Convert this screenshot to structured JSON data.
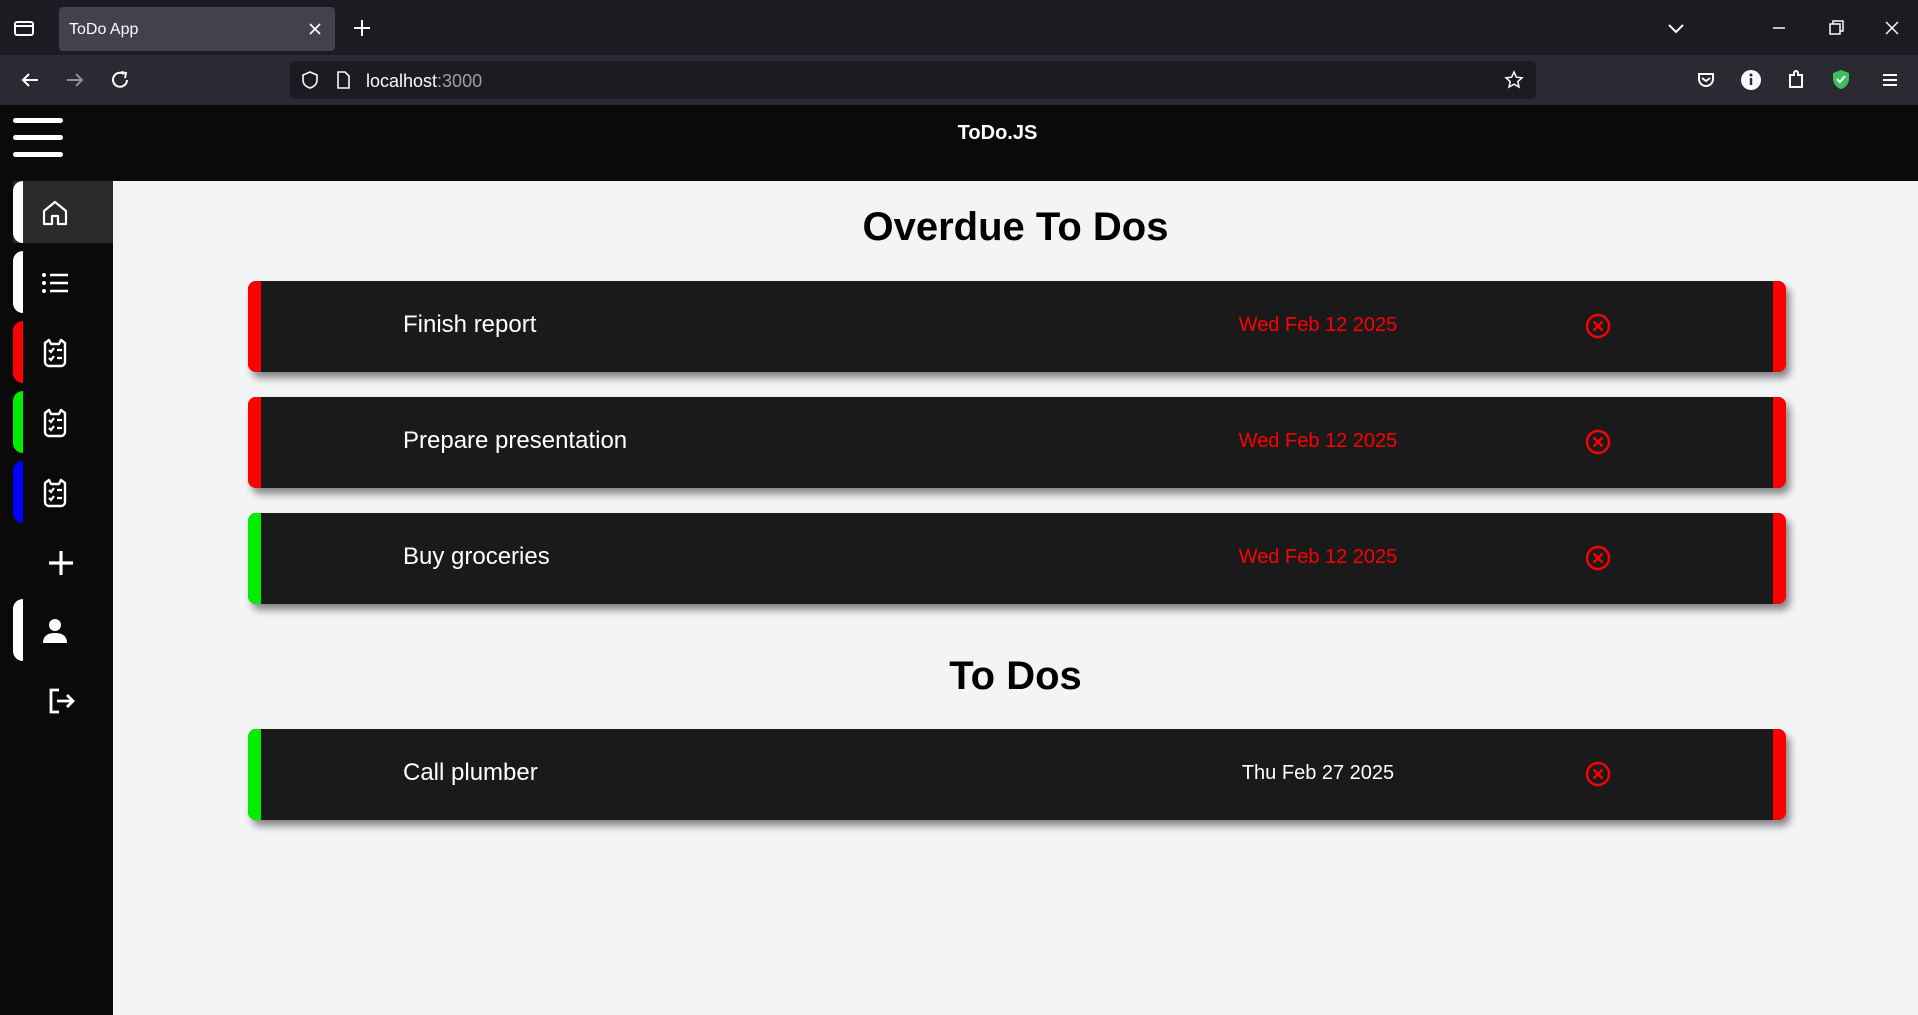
{
  "browser": {
    "tab_title": "ToDo App",
    "url_host": "localhost",
    "url_port": ":3000"
  },
  "app": {
    "title": "ToDo.JS",
    "sidebar": [
      {
        "name": "home",
        "icon": "home-icon",
        "color": "#ffffff",
        "active": true
      },
      {
        "name": "list",
        "icon": "list-icon",
        "color": "#ffffff"
      },
      {
        "name": "red-category",
        "icon": "checklist-icon",
        "color": "#ff0000"
      },
      {
        "name": "green-category",
        "icon": "checklist-icon",
        "color": "#00ee00"
      },
      {
        "name": "blue-category",
        "icon": "checklist-icon",
        "color": "#0000ff"
      },
      {
        "name": "add",
        "icon": "plus-icon"
      },
      {
        "name": "profile",
        "icon": "user-icon",
        "color": "#ffffff"
      },
      {
        "name": "logout",
        "icon": "logout-icon"
      }
    ]
  },
  "sections": {
    "overdue_title": "Overdue To Dos",
    "todos_title": "To Dos"
  },
  "overdue": [
    {
      "name": "Finish report",
      "date": "Wed Feb 12 2025",
      "category_color": "#ff0000"
    },
    {
      "name": "Prepare presentation",
      "date": "Wed Feb 12 2025",
      "category_color": "#ff0000"
    },
    {
      "name": "Buy groceries",
      "date": "Wed Feb 12 2025",
      "category_color": "#00ee00"
    }
  ],
  "todos": [
    {
      "name": "Call plumber",
      "date": "Thu Feb 27 2025",
      "category_color": "#00ee00"
    }
  ],
  "colors": {
    "overdue_date": "#ff0000",
    "normal_date": "#ffffff",
    "right_bar": "#ff0000",
    "delete_icon": "#ff0000"
  }
}
